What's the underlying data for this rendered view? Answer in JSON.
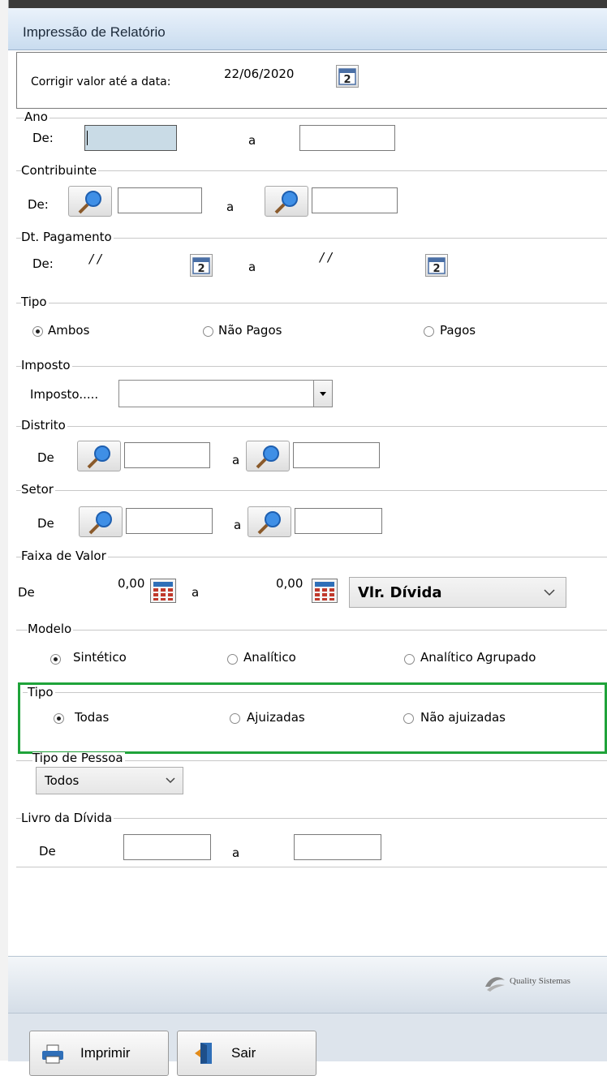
{
  "window": {
    "title": "Impressão de Relatório"
  },
  "correct": {
    "label": "Corrigir valor até a data:",
    "date": "22/06/2020"
  },
  "ano": {
    "legend": "Ano",
    "from_label": "De:",
    "to_label": "a",
    "from_value": "",
    "to_value": ""
  },
  "contribuinte": {
    "legend": "Contribuinte",
    "from_label": "De:",
    "to_label": "a",
    "from_value": "",
    "to_value": ""
  },
  "dt_pagamento": {
    "legend": "Dt. Pagamento",
    "from_label": "De:",
    "to_label": "a",
    "from_value": "/ /",
    "to_value": "/ /"
  },
  "tipo1": {
    "legend": "Tipo",
    "options": [
      "Ambos",
      "Não Pagos",
      "Pagos"
    ],
    "selected": "Ambos"
  },
  "imposto": {
    "legend": "Imposto",
    "label": "Imposto.....",
    "value": ""
  },
  "distrito": {
    "legend": "Distrito",
    "from_label": "De",
    "to_label": "a",
    "from_value": "",
    "to_value": ""
  },
  "setor": {
    "legend": "Setor",
    "from_label": "De",
    "to_label": "a",
    "from_value": "",
    "to_value": ""
  },
  "faixa": {
    "legend": "Faixa de Valor",
    "from_label": "De",
    "to_label": "a",
    "from_value": "0,00",
    "to_value": "0,00",
    "type_value": "Vlr. Dívida"
  },
  "modelo": {
    "legend": "Modelo",
    "options": [
      "Sintético",
      "Analítico",
      "Analítico Agrupado"
    ],
    "selected": "Sintético"
  },
  "tipo2": {
    "legend": "Tipo",
    "options": [
      "Todas",
      "Ajuizadas",
      "Não ajuizadas"
    ],
    "selected": "Todas"
  },
  "tipo_pessoa": {
    "legend": "Tipo de Pessoa",
    "value": "Todos"
  },
  "livro": {
    "legend": "Livro da Dívida",
    "from_label": "De",
    "to_label": "a",
    "from_value": "",
    "to_value": ""
  },
  "footer": {
    "brand": "Quality Sistemas",
    "print_label": "Imprimir",
    "exit_label": "Sair"
  },
  "colors": {
    "highlight": "#1fa33a",
    "title_bar": "#c9dcef",
    "focus": "#c9dbe6"
  }
}
